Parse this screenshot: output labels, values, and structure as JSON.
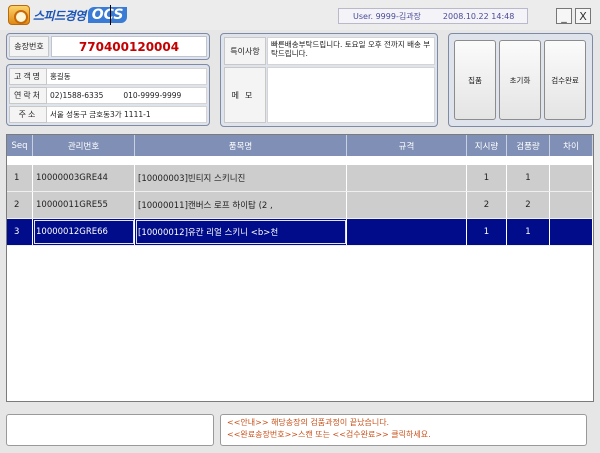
{
  "app": {
    "logo_text": "스피드경영",
    "logo_suffix": "OCS",
    "user": "User. 9999-김과장",
    "datetime": "2008.10.22 14:48",
    "minimize_glyph": "_",
    "close_glyph": "X"
  },
  "order": {
    "label": "송장번호",
    "value": "770400120004"
  },
  "customer": {
    "name_label": "고객명",
    "name": "홍길동",
    "contact_label": "연락처",
    "phone1": "02)1588-6335",
    "phone2": "010-9999-9999",
    "address_label": "주소",
    "address": "서울 성동구 금호동3가 1111-1"
  },
  "notes": {
    "special_label": "특이사항",
    "special_text": "빠른배송부탁드립니다. 토요일 오후 전까지 배송 부탁드립니다.",
    "memo_label": "메모",
    "memo_text": ""
  },
  "actions": {
    "pick": "집품",
    "reset": "초기화",
    "complete": "검수완료"
  },
  "table": {
    "headers": [
      "Seq",
      "관리번호",
      "품목명",
      "규격",
      "지시량",
      "검품량",
      "차이"
    ],
    "rows": [
      {
        "seq": "1",
        "code": "10000003GRE44",
        "name": "[10000003]빈티지 스키니진",
        "spec": "",
        "ordered": "1",
        "checked": "1",
        "diff": ""
      },
      {
        "seq": "2",
        "code": "10000011GRE55",
        "name": "[10000011]캔버스 로프 하이탑        (2 ,",
        "spec": "",
        "ordered": "2",
        "checked": "2",
        "diff": ""
      },
      {
        "seq": "3",
        "code": "10000012GRE66",
        "name": "[10000012]유칸 리얼 스키니         <b>천",
        "spec": "",
        "ordered": "1",
        "checked": "1",
        "diff": ""
      }
    ],
    "selected_row": 3
  },
  "scan": {
    "value": ""
  },
  "message": {
    "line1": "<<안내>> 해당송장의 검품과정이 끝났습니다.",
    "line2": "<<완료송장번호>>스캔 또는 <<검수완료>> 클릭하세요."
  },
  "colors": {
    "header_bg": "#7f8fb5",
    "row_bg": "#cdcdcd",
    "selected_bg": "#000c8a",
    "order_number": "#c40000",
    "message_text": "#c8501a"
  }
}
